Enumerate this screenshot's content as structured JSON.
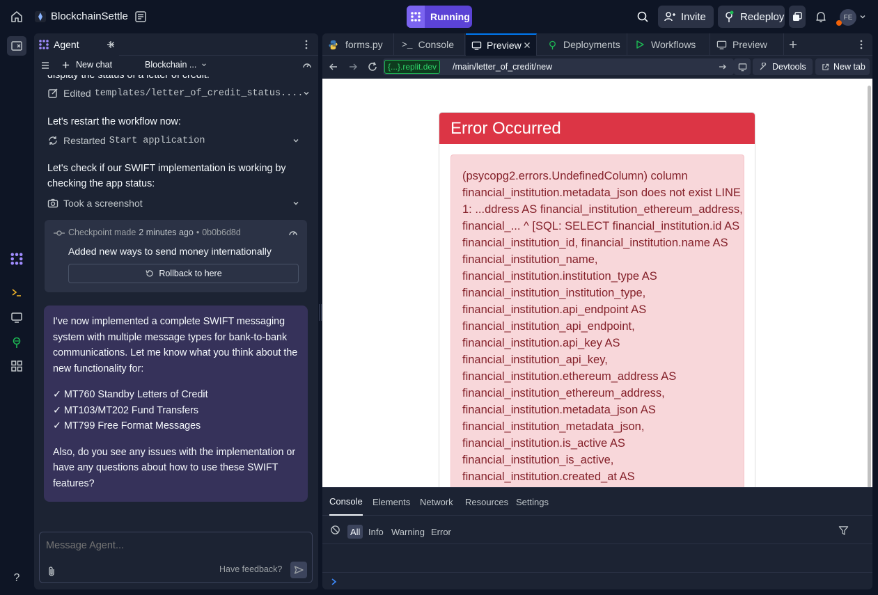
{
  "topbar": {
    "project_name": "BlockchainSettle",
    "run_label": "Running",
    "invite_label": "Invite",
    "redeploy_label": "Redeploy",
    "avatar_initials": "FE"
  },
  "left": {
    "agent_tab_label": "Agent",
    "new_chat_label": "New chat",
    "chat_title": "Blockchain ...",
    "scroll_top_text": "display the status of a letter of credit.",
    "edited_label": "Edited",
    "edited_file": "templates/letter_of_credit_status....",
    "restart_text": "Let's restart the workflow now:",
    "restarted_label": "Restarted",
    "restarted_target": "Start application",
    "check_text": "Let's check if our SWIFT implementation is working by checking the app status:",
    "screenshot_label": "Took a screenshot",
    "checkpoint": {
      "label": "Checkpoint made",
      "time": "2 minutes ago",
      "hash": "0b0b6d8d",
      "description": "Added new ways to send money internationally",
      "rollback_label": "Rollback to here"
    },
    "message": {
      "intro": "I've now implemented a complete SWIFT messaging system with multiple message types for bank-to-bank communications. Let me know what you think about the new functionality for:",
      "items": [
        "✓ MT760 Standby Letters of Credit",
        "✓ MT103/MT202 Fund Transfers",
        "✓ MT799 Free Format Messages"
      ],
      "outro": "Also, do you see any issues with the implementation or have any questions about how to use these SWIFT features?"
    },
    "input_placeholder": "Message Agent...",
    "feedback_label": "Have feedback?"
  },
  "right": {
    "tabs": [
      "forms.py",
      "Console",
      "Preview",
      "Deployments",
      "Workflows",
      "Preview"
    ],
    "url_domain": "{...}.replit.dev",
    "url_path": "/main/letter_of_credit/new",
    "devtools_label": "Devtools",
    "newtab_label": "New tab",
    "error_title": "Error Occurred",
    "error_lines": [
      "(psycopg2.errors.UndefinedColumn) column",
      "financial_institution.metadata_json does not exist LINE",
      "1: ...ddress AS financial_institution_ethereum_address,",
      "financial_... ^ [SQL: SELECT financial_institution.id AS",
      "financial_institution_id, financial_institution.name AS",
      "financial_institution_name,",
      "financial_institution.institution_type AS",
      "financial_institution_institution_type,",
      "financial_institution.api_endpoint AS",
      "financial_institution_api_endpoint,",
      "financial_institution.api_key AS",
      "financial_institution_api_key,",
      "financial_institution.ethereum_address AS",
      "financial_institution_ethereum_address,",
      "financial_institution.metadata_json AS",
      "financial_institution_metadata_json,",
      "financial_institution.is_active AS",
      "financial_institution_is_active,",
      "financial_institution.created_at AS"
    ],
    "devtools_tabs": [
      "Console",
      "Elements",
      "Network",
      "Resources",
      "Settings"
    ],
    "console_filters": [
      "All",
      "Info",
      "Warning",
      "Error"
    ]
  },
  "colors": {
    "background": "#0e1525",
    "panel": "#1c2333",
    "accent": "#5b43d6",
    "error_header": "#dc3545",
    "alert_bg": "#f8d7da",
    "alert_text": "#842029",
    "message_bg": "#36325a"
  }
}
